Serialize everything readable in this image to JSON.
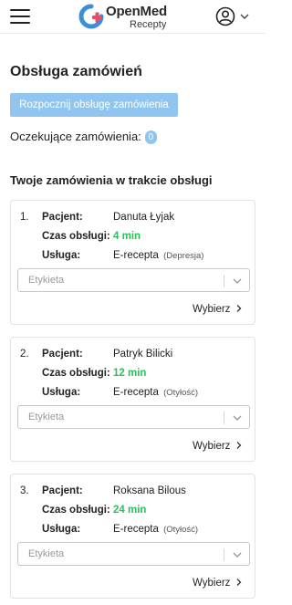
{
  "header": {
    "brand_name": "OpenMed",
    "brand_sub": "Recepty",
    "icons": [
      "menu-icon",
      "logo-icon",
      "account-icon",
      "chevron-down-icon"
    ]
  },
  "main": {
    "title": "Obsługa zamówień",
    "start_button": "Rozpocznij obsługę zamówienia",
    "pending_label": "Oczekujące zamówienia:",
    "pending_count": "0",
    "section_title": "Twoje zamówienia w trakcie obsługi",
    "accent_color": "#8fc5ee",
    "time_color": "#28c25b"
  },
  "orders": [
    {
      "number": "1.",
      "patient_label": "Pacjent:",
      "patient": "Danuta Łyjak",
      "time_label": "Czas obsługi:",
      "time": "4 min",
      "service_label": "Usługa:",
      "service": "E-recepta",
      "service_note": "(Depresja)",
      "label_placeholder": "Etykieta",
      "choose": "Wybierz"
    },
    {
      "number": "2.",
      "patient_label": "Pacjent:",
      "patient": "Patryk Bilicki",
      "time_label": "Czas obsługi:",
      "time": "12 min",
      "service_label": "Usługa:",
      "service": "E-recepta",
      "service_note": "(Otyłość)",
      "label_placeholder": "Etykieta",
      "choose": "Wybierz"
    },
    {
      "number": "3.",
      "patient_label": "Pacjent:",
      "patient": "Roksana Bilous",
      "time_label": "Czas obsługi:",
      "time": "24 min",
      "service_label": "Usługa:",
      "service": "E-recepta",
      "service_note": "(Otyłość)",
      "label_placeholder": "Etykieta",
      "choose": "Wybierz"
    }
  ]
}
